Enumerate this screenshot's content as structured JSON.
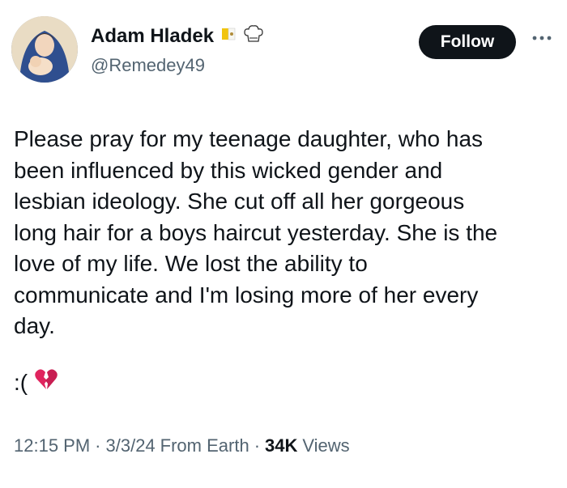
{
  "author": {
    "display_name": "Adam Hladek",
    "handle": "@Remedey49"
  },
  "header": {
    "follow_label": "Follow",
    "badges": [
      "vatican-flag-icon",
      "chef-hat-icon"
    ],
    "more_icon": "more-horizontal-icon"
  },
  "tweet": {
    "text": "Please pray for my teenage daughter, who has\nbeen influenced by this wicked gender and\nlesbian ideology. She cut off all her gorgeous\nlong hair for a boys haircut yesterday. She is the\nlove of my life. We lost the ability to\ncommunicate and I'm losing more of her every\nday.",
    "emoticon": ":(",
    "emoji": "broken-heart-icon"
  },
  "meta": {
    "time": "12:15 PM",
    "sep1": "·",
    "date": "3/3/24",
    "location": "From Earth",
    "sep2": "·",
    "views_count": "34K",
    "views_label": "Views"
  },
  "colors": {
    "text": "#0f1419",
    "secondary": "#536471",
    "follow_bg": "#0f1419",
    "heart": "#e0245e"
  }
}
